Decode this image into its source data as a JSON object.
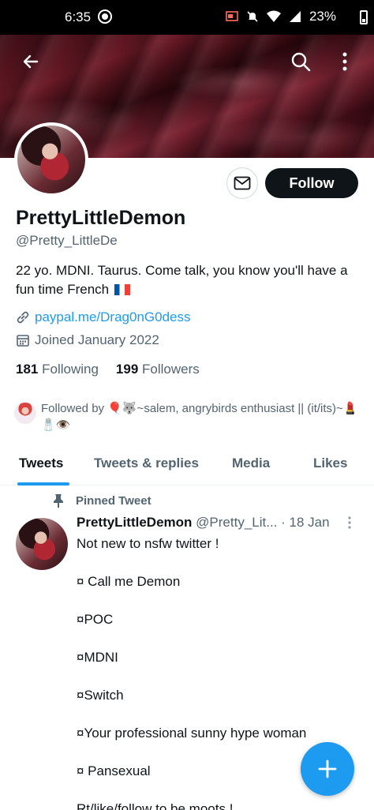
{
  "status_bar": {
    "time": "6:35",
    "battery": "23%"
  },
  "profile": {
    "display_name": "PrettyLittleDemon",
    "handle": "@Pretty_LittleDe",
    "bio": "22 yo. MDNI. Taurus.  Come talk, you know you'll have a fun time French",
    "link": "paypal.me/Drag0nG0dess",
    "joined": "Joined January 2022",
    "following_count": "181",
    "following_label": "Following",
    "followers_count": "199",
    "followers_label": "Followers",
    "follow_button": "Follow",
    "followed_by": "Followed by 🎈🐺~salem, angrybirds enthusiast || (it/its)~💄🧂👁️"
  },
  "tabs": [
    {
      "label": "Tweets",
      "active": true
    },
    {
      "label": "Tweets & replies",
      "active": false
    },
    {
      "label": "Media",
      "active": false
    },
    {
      "label": "Likes",
      "active": false
    }
  ],
  "pinned_tweet": {
    "pinned_label": "Pinned Tweet",
    "author_name": "PrettyLittleDemon",
    "author_handle": "@Pretty_Lit...",
    "date": "· 18 Jan",
    "lines": [
      "Not new to nsfw twitter !",
      "¤ Call me Demon",
      "¤POC",
      "¤MDNI",
      "¤Switch",
      "¤Your professional sunny hype woman",
      "¤ Pansexual",
      "Rt/like/follow to be moots !"
    ]
  },
  "icons": {
    "back": "arrow-left-icon",
    "search": "search-icon",
    "more": "more-vertical-icon",
    "mail": "mail-icon",
    "link": "link-icon",
    "calendar": "calendar-icon",
    "pin": "pin-icon",
    "compose": "plus-icon"
  },
  "colors": {
    "accent": "#1d9bf0",
    "text": "#0f1419",
    "muted": "#536471"
  }
}
